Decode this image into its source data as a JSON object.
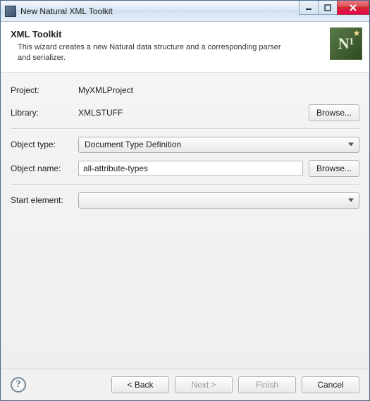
{
  "window": {
    "title": "New Natural XML Toolkit"
  },
  "banner": {
    "heading": "XML Toolkit",
    "description": "This wizard creates a new Natural data structure and a corresponding parser and serializer.",
    "logo_text": "N¹"
  },
  "form": {
    "project_label": "Project:",
    "project_value": "MyXMLProject",
    "library_label": "Library:",
    "library_value": "XMLSTUFF",
    "browse_label": "Browse...",
    "object_type_label": "Object type:",
    "object_type_value": "Document Type Definition",
    "object_name_label": "Object name:",
    "object_name_value": "all-attribute-types",
    "start_element_label": "Start element:",
    "start_element_value": ""
  },
  "footer": {
    "back_label": "< Back",
    "next_label": "Next >",
    "finish_label": "Finish",
    "cancel_label": "Cancel"
  }
}
